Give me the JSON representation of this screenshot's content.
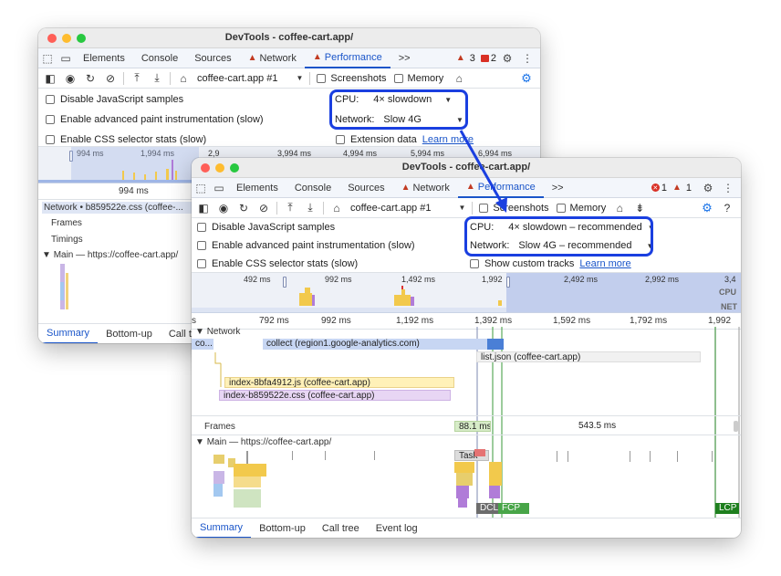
{
  "back_window": {
    "title": "DevTools - coffee-cart.app/",
    "tabs": [
      "Elements",
      "Console",
      "Sources",
      "Network",
      "Performance"
    ],
    "more_tabs": ">>",
    "warning_count": "3",
    "message_count": "2",
    "url": "coffee-cart.app #1",
    "screenshots_label": "Screenshots",
    "memory_label": "Memory",
    "disable_js": "Disable JavaScript samples",
    "adv_paint": "Enable advanced paint instrumentation (slow)",
    "css_stats": "Enable CSS selector stats (slow)",
    "cpu_label": "CPU:",
    "cpu_value": "4× slowdown",
    "network_label": "Network:",
    "network_value": "Slow 4G",
    "extension_label": "Extension data",
    "learn_more": "Learn more",
    "overview_ticks": [
      "994 ms",
      "1,994 ms",
      "2,9",
      "3,994 ms",
      "4,994 ms",
      "5,994 ms",
      "6,994 ms"
    ],
    "ruler_tick": "994 ms",
    "network_row": "Network • b859522e.css (coffee-...",
    "frames_label": "Frames",
    "timings_label": "Timings",
    "main_label": "Main — https://coffee-cart.app/",
    "bottom_tabs": [
      "Summary",
      "Bottom-up",
      "Call tre"
    ]
  },
  "front_window": {
    "title": "DevTools - coffee-cart.app/",
    "tabs": [
      "Elements",
      "Console",
      "Sources",
      "Network",
      "Performance"
    ],
    "more_tabs": ">>",
    "error_count": "1",
    "warning_count": "1",
    "url": "coffee-cart.app #1",
    "screenshots_label": "Screenshots",
    "memory_label": "Memory",
    "disable_js": "Disable JavaScript samples",
    "adv_paint": "Enable advanced paint instrumentation (slow)",
    "css_stats": "Enable CSS selector stats (slow)",
    "cpu_label": "CPU:",
    "cpu_value": "4× slowdown – recommended",
    "network_label": "Network:",
    "network_value": "Slow 4G – recommended",
    "custom_tracks": "Show custom tracks",
    "learn_more": "Learn more",
    "overview_ticks": [
      "492 ms",
      "992 ms",
      "1,492 ms",
      "1,992",
      "2,492 ms",
      "2,992 ms",
      "3,4"
    ],
    "cpu_tag": "CPU",
    "net_tag": "NET",
    "ruler_ticks": [
      "s",
      "792 ms",
      "992 ms",
      "1,192 ms",
      "1,392 ms",
      "1,592 ms",
      "1,792 ms",
      "1,992"
    ],
    "network_track": "Network",
    "requests": {
      "co": "co...",
      "collect": "collect (region1.google-analytics.com)",
      "list": "list.json (coffee-cart.app)",
      "index_js": "index-8bfa4912.js (coffee-cart.app)",
      "index_css": "index-b859522e.css (coffee-cart.app)"
    },
    "frames_label": "Frames",
    "frame_1": "88.1 ms",
    "frame_2": "543.5 ms",
    "main_label": "Main — https://coffee-cart.app/",
    "task_label": "Task",
    "dcl": "DCL",
    "fcp": "FCP",
    "lcp": "LCP",
    "bottom_tabs": [
      "Summary",
      "Bottom-up",
      "Call tree",
      "Event log"
    ]
  },
  "colors": {
    "accent": "#1a55c9",
    "callout": "#1a3fe0"
  }
}
